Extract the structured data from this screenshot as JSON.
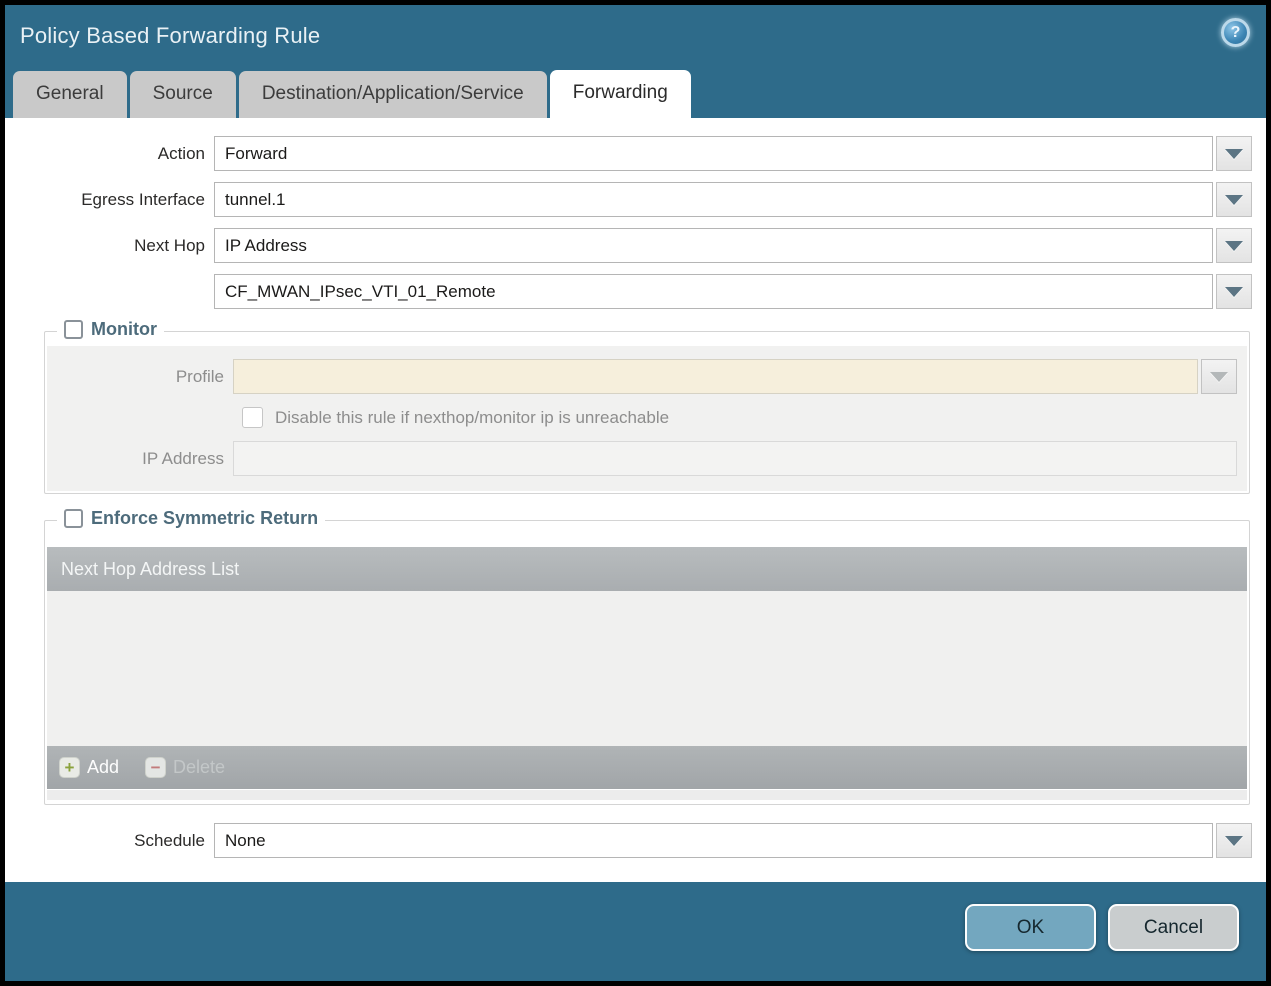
{
  "window": {
    "title": "Policy Based Forwarding Rule"
  },
  "help": {
    "glyph": "?"
  },
  "tabs": {
    "general": {
      "label": "General"
    },
    "source": {
      "label": "Source"
    },
    "destination": {
      "label": "Destination/Application/Service"
    },
    "forwarding": {
      "label": "Forwarding"
    }
  },
  "form": {
    "action": {
      "label": "Action",
      "value": "Forward"
    },
    "egress_interface": {
      "label": "Egress Interface",
      "value": "tunnel.1"
    },
    "next_hop": {
      "label": "Next Hop",
      "value": "IP Address"
    },
    "next_hop_address": {
      "value": "CF_MWAN_IPsec_VTI_01_Remote"
    },
    "schedule": {
      "label": "Schedule",
      "value": "None"
    }
  },
  "monitor": {
    "label": "Monitor",
    "checked": false,
    "profile": {
      "label": "Profile",
      "value": ""
    },
    "disable_rule": {
      "label": "Disable this rule if nexthop/monitor ip is unreachable",
      "checked": false
    },
    "ip_address": {
      "label": "IP Address",
      "value": ""
    }
  },
  "symmetric_return": {
    "label": "Enforce Symmetric Return",
    "checked": false,
    "table": {
      "header": "Next Hop Address List",
      "rows": []
    },
    "add_label": "Add",
    "delete_label": "Delete",
    "add_glyph": "+",
    "delete_glyph": "−"
  },
  "footer": {
    "ok_label": "OK",
    "cancel_label": "Cancel"
  },
  "colors": {
    "titlebar": "#2e6b8a",
    "ok_button": "#73a7bf",
    "profile_disabled_bg": "#f6efdc"
  }
}
